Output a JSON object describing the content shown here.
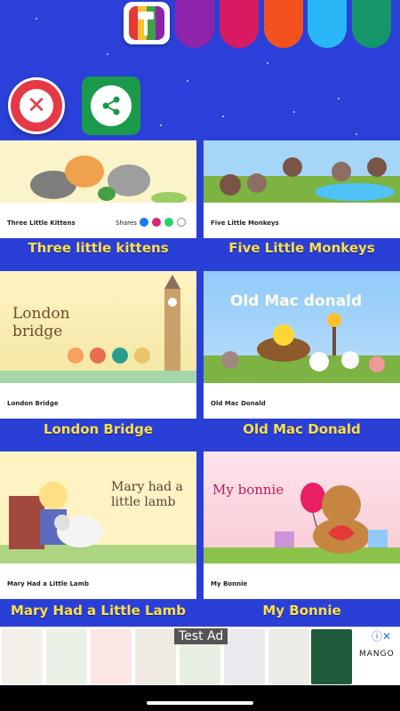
{
  "top_bar": {
    "palette_icon": "paint-roller-icon",
    "swatches": [
      "#8e24aa",
      "#d81b60",
      "#f4511e",
      "#29b6f6",
      "#15956a"
    ]
  },
  "actions": {
    "close_icon": "close-icon",
    "share_icon": "share-icon"
  },
  "songs": [
    {
      "thumb_title": "Three Little Kittens",
      "label": "Three little kittens",
      "shares_label": "Shares"
    },
    {
      "thumb_title": "Five Little Monkeys",
      "label": "Five Little Monkeys"
    },
    {
      "thumb_title": "London Bridge",
      "label": "London Bridge",
      "art_text": "London bridge"
    },
    {
      "thumb_title": "Old Mac Donald",
      "label": "Old Mac Donald",
      "art_text": "Old Mac donald"
    },
    {
      "thumb_title": "Mary Had a Little Lamb",
      "label": "Mary Had a Little Lamb",
      "art_text": "Mary had a little lamb"
    },
    {
      "thumb_title": "My Bonnie",
      "label": "My Bonnie",
      "art_text": "My bonnie"
    }
  ],
  "ad": {
    "badge": "Test Ad",
    "brand": "MANGO"
  }
}
